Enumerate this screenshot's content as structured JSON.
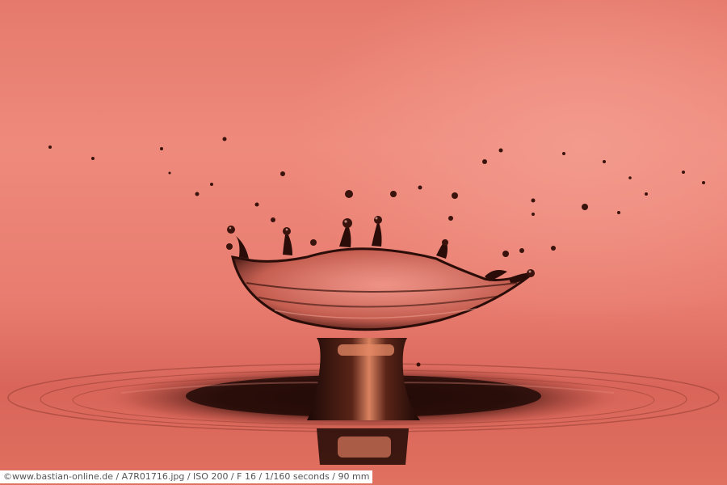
{
  "photo": {
    "subject": "water-drop-crown-splash",
    "colors": {
      "background": "#ea7f72",
      "highlight": "#f39a8d",
      "shadow": "#1e0b08",
      "liquid_glow": "#e0846a"
    }
  },
  "caption": {
    "text": "©www.bastian-online.de / A7R01716.jpg / ISO 200 / F 16 / 1/160 seconds  / 90 mm"
  }
}
